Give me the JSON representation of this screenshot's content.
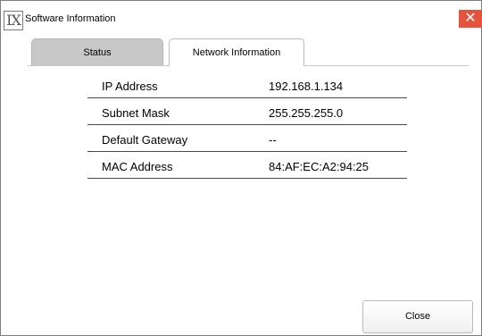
{
  "window": {
    "title": "Software Information",
    "app_icon_text": "IX",
    "close_glyph": "✕",
    "accent_close_color": "#e5533d"
  },
  "tabs": [
    {
      "label": "Status",
      "selected": false
    },
    {
      "label": "Network Information",
      "selected": true
    }
  ],
  "network": {
    "rows": [
      {
        "label": "IP Address",
        "value": "192.168.1.134"
      },
      {
        "label": "Subnet Mask",
        "value": "255.255.255.0"
      },
      {
        "label": "Default Gateway",
        "value": "--"
      },
      {
        "label": "MAC Address",
        "value": "84:AF:EC:A2:94:25"
      }
    ]
  },
  "footer": {
    "close_label": "Close"
  },
  "icons": {
    "app": "ix-logo-icon",
    "close": "close-icon"
  }
}
